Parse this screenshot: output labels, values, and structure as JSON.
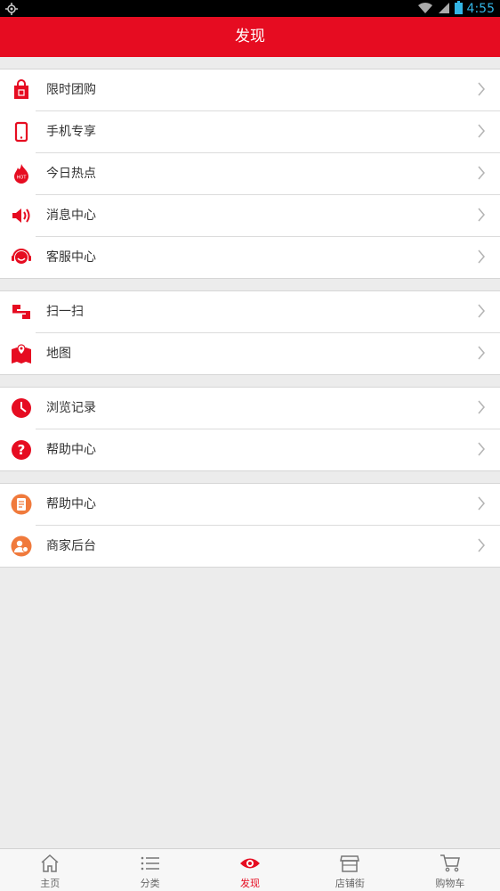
{
  "status_bar": {
    "time": "4:55"
  },
  "header": {
    "title": "发现"
  },
  "groups": [
    {
      "items": [
        {
          "label": "限时团购",
          "icon": "shopping-bag-icon"
        },
        {
          "label": "手机专享",
          "icon": "phone-icon"
        },
        {
          "label": "今日热点",
          "icon": "hot-flame-icon"
        },
        {
          "label": "消息中心",
          "icon": "speaker-icon"
        },
        {
          "label": "客服中心",
          "icon": "headset-icon"
        }
      ]
    },
    {
      "items": [
        {
          "label": "扫一扫",
          "icon": "scan-icon"
        },
        {
          "label": "地图",
          "icon": "map-icon"
        }
      ]
    },
    {
      "items": [
        {
          "label": "浏览记录",
          "icon": "clock-icon"
        },
        {
          "label": "帮助中心",
          "icon": "question-icon"
        }
      ]
    },
    {
      "items": [
        {
          "label": "帮助中心",
          "icon": "document-icon"
        },
        {
          "label": "商家后台",
          "icon": "merchant-icon"
        }
      ]
    }
  ],
  "tabbar": {
    "tabs": [
      {
        "label": "主页",
        "icon": "home-icon"
      },
      {
        "label": "分类",
        "icon": "list-icon"
      },
      {
        "label": "发现",
        "icon": "eye-icon",
        "active": true
      },
      {
        "label": "店铺街",
        "icon": "store-icon"
      },
      {
        "label": "购物车",
        "icon": "cart-icon"
      }
    ]
  },
  "colors": {
    "brand": "#e60c21",
    "accent_orange": "#f07a3c",
    "background": "#ececec"
  }
}
